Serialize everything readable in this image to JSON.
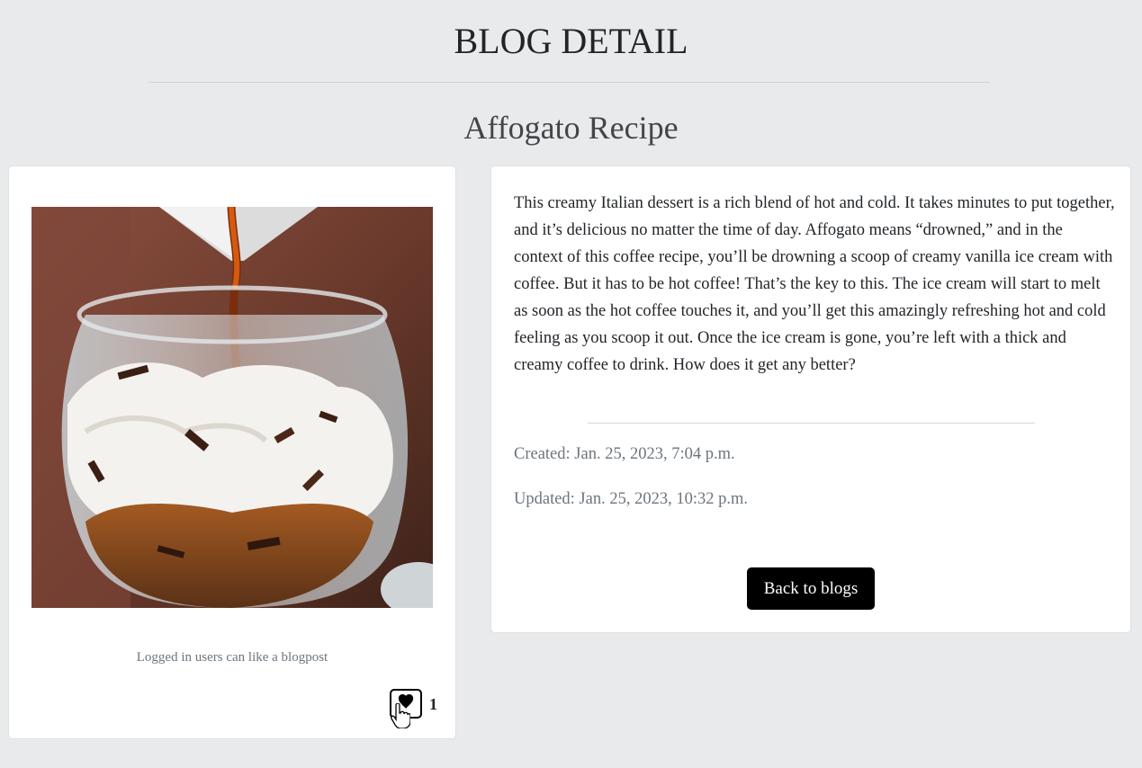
{
  "header": {
    "page_title": "BLOG DETAIL",
    "post_title": "Affogato Recipe"
  },
  "image_card": {
    "photo_alt": "Affogato: hot espresso poured over vanilla ice cream with chocolate shavings in a glass",
    "like_hint": "Logged in users can like a blogpost",
    "like_icon": "heart-icon",
    "like_count": "1"
  },
  "content_card": {
    "body": "This creamy Italian dessert is a rich blend of hot and cold. It takes minutes to put together, and it’s delicious no matter the time of day. Affogato means “drowned,” and in the context of this coffee recipe, you’ll be drowning a scoop of creamy vanilla ice cream with coffee. But it has to be hot coffee! That’s the key to this. The ice cream will start to melt as soon as the hot coffee touches it, and you’ll get this amazingly refreshing hot and cold feeling as you scoop it out. Once the ice cream is gone, you’re left with a thick and creamy coffee to drink. How does it get any better?",
    "created": "Created: Jan. 25, 2023, 7:04 p.m.",
    "updated": "Updated: Jan. 25, 2023, 10:32 p.m.",
    "back_label": "Back to blogs"
  },
  "colors": {
    "background": "#e9eaeb",
    "card": "#ffffff",
    "button": "#000000",
    "muted_text": "#6c757d"
  }
}
